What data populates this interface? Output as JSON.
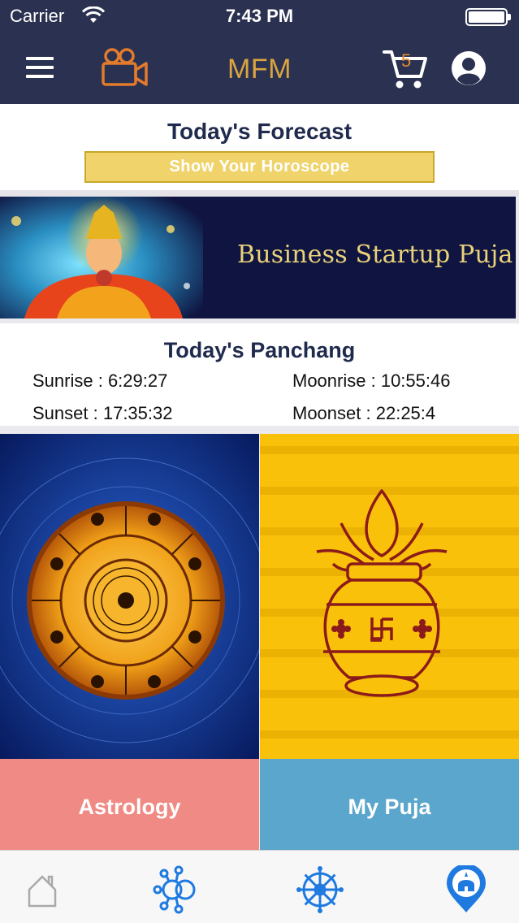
{
  "status_bar": {
    "carrier": "Carrier",
    "time": "7:43 PM"
  },
  "navbar": {
    "title": "MFM",
    "cart_count": "5",
    "icons": [
      "menu-icon",
      "video-camera-icon",
      "cart-icon",
      "user-profile-icon"
    ]
  },
  "forecast": {
    "title": "Today's Forecast",
    "button_label": "Show Your Horoscope"
  },
  "banner": {
    "text": "Business Startup Puja"
  },
  "panchang": {
    "title": "Today's Panchang",
    "sunrise_label": "Sunrise",
    "sunrise_value": "6:29:27",
    "moonrise_label": "Moonrise",
    "moonrise_value": "10:55:46",
    "sunset_label": "Sunset",
    "sunset_value": "17:35:32",
    "moonset_label": "Moonset",
    "moonset_value": "22:25:4"
  },
  "tiles": [
    {
      "label": "Astrology",
      "image": "zodiac-wheel-image"
    },
    {
      "label": "My Puja",
      "image": "kalash-image"
    }
  ],
  "tabbar": {
    "items": [
      "home-icon",
      "planets-icon",
      "dharma-wheel-icon",
      "temple-location-icon"
    ],
    "active_index": 3
  },
  "colors": {
    "header_bg": "#2b3150",
    "title_gold": "#d9a441",
    "heading_navy": "#1f2a4d",
    "button_yellow": "#f0d36b",
    "astrology_label": "#f08a84",
    "puja_label": "#5aa6cc",
    "tab_icon_blue": "#1f7ae0"
  }
}
